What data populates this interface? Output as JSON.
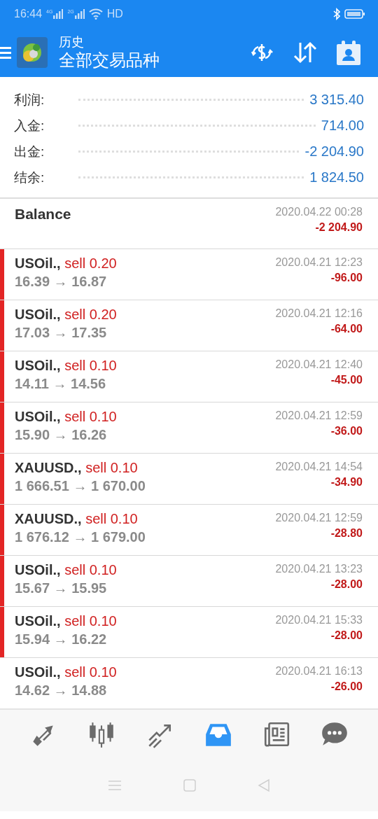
{
  "status_bar": {
    "time": "16:44",
    "signals": [
      "4G",
      "2G"
    ],
    "network": "HD"
  },
  "toolbar": {
    "title": "历史",
    "subtitle": "全部交易品种"
  },
  "summary": [
    {
      "label": "利润:",
      "value": "3 315.40"
    },
    {
      "label": "入金:",
      "value": "714.00"
    },
    {
      "label": "出金:",
      "value": "-2 204.90"
    },
    {
      "label": "结余:",
      "value": "1 824.50"
    }
  ],
  "balance": {
    "label": "Balance",
    "time": "2020.04.22 00:28",
    "amount": "-2 204.90"
  },
  "deals": [
    {
      "symbol": "USOil.,",
      "side": "sell 0.20",
      "prices": "16.39 → 16.87",
      "time": "2020.04.21 12:23",
      "profit": "-96.00",
      "flagged": true
    },
    {
      "symbol": "USOil.,",
      "side": "sell 0.20",
      "prices": "17.03 → 17.35",
      "time": "2020.04.21 12:16",
      "profit": "-64.00",
      "flagged": true
    },
    {
      "symbol": "USOil.,",
      "side": "sell 0.10",
      "prices": "14.11 → 14.56",
      "time": "2020.04.21 12:40",
      "profit": "-45.00",
      "flagged": true
    },
    {
      "symbol": "USOil.,",
      "side": "sell 0.10",
      "prices": "15.90 → 16.26",
      "time": "2020.04.21 12:59",
      "profit": "-36.00",
      "flagged": true
    },
    {
      "symbol": "XAUUSD.,",
      "side": "sell 0.10",
      "prices": "1 666.51 → 1 670.00",
      "time": "2020.04.21 14:54",
      "profit": "-34.90",
      "flagged": true
    },
    {
      "symbol": "XAUUSD.,",
      "side": "sell 0.10",
      "prices": "1 676.12 → 1 679.00",
      "time": "2020.04.21 12:59",
      "profit": "-28.80",
      "flagged": true
    },
    {
      "symbol": "USOil.,",
      "side": "sell 0.10",
      "prices": "15.67 → 15.95",
      "time": "2020.04.21 13:23",
      "profit": "-28.00",
      "flagged": true
    },
    {
      "symbol": "USOil.,",
      "side": "sell 0.10",
      "prices": "15.94 → 16.22",
      "time": "2020.04.21 15:33",
      "profit": "-28.00",
      "flagged": true
    },
    {
      "symbol": "USOil.,",
      "side": "sell 0.10",
      "prices": "14.62 → 14.88",
      "time": "2020.04.21 16:13",
      "profit": "-26.00",
      "flagged": false
    }
  ],
  "bottom_nav": [
    {
      "kind": "quotes",
      "selected": false
    },
    {
      "kind": "chart",
      "selected": false
    },
    {
      "kind": "trade",
      "selected": false
    },
    {
      "kind": "history",
      "selected": true
    },
    {
      "kind": "news",
      "selected": false
    },
    {
      "kind": "chat",
      "selected": false
    }
  ]
}
